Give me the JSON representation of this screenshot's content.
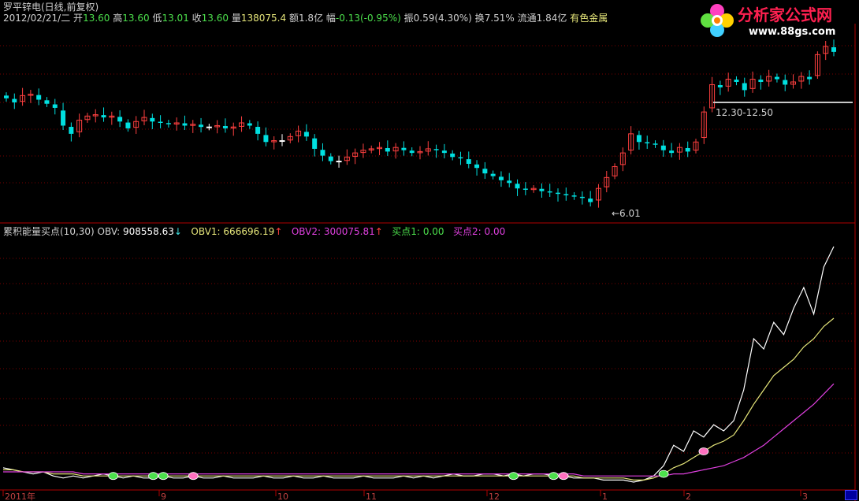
{
  "header": {
    "title": "罗平锌电(日线,前复权)",
    "date": "2012/02/21/二",
    "open_label": "开",
    "open": "13.60",
    "high_label": "高",
    "high": "13.60",
    "low_label": "低",
    "low": "13.01",
    "close_label": "收",
    "close": "13.60",
    "volume_label": "量",
    "volume": "138075.4",
    "amount_label": "额",
    "amount": "1.8亿",
    "change_label": "幅",
    "change": "-0.13(-0.95%)",
    "amplitude_label": "振",
    "amplitude": "0.59(4.30%)",
    "turnover_label": "换",
    "turnover": "7.51%",
    "float_label": "流通",
    "float": "1.84亿",
    "sector": "有色金属"
  },
  "logo": {
    "name": "分析家公式网",
    "url": "www.88gs.com"
  },
  "price_annotations": {
    "high_range": "12.30-12.50",
    "low_marker": "←6.01"
  },
  "indicator": {
    "name": "累积能量买点(10,30)",
    "obv_label": "OBV:",
    "obv": "908558.63",
    "obv_arrow": "↓",
    "obv1_label": "OBV1:",
    "obv1": "666696.19",
    "obv1_arrow": "↑",
    "obv2_label": "OBV2:",
    "obv2": "300075.81",
    "obv2_arrow": "↑",
    "buy1_label": "买点1:",
    "buy1": "0.00",
    "buy2_label": "买点2:",
    "buy2": "0.00"
  },
  "xaxis": {
    "labels": [
      "2011年",
      "9",
      "10",
      "11",
      "12",
      "1",
      "2",
      "3"
    ]
  },
  "colors": {
    "up": "#ff4040",
    "down": "#00e0e0",
    "doji": "#ffffff",
    "obv": "#ffffff",
    "obv1": "#e6e67a",
    "obv2": "#e040e0",
    "buy1": "#4ce04c",
    "buy2": "#ff70c0",
    "grid": "#7a0000"
  },
  "chart_data": [
    {
      "type": "candlestick",
      "title": "罗平锌电(日线,前复权)",
      "y_markers": {
        "high": "12.30-12.50",
        "low": 6.01
      },
      "series": [
        {
          "closes": [
            9.9,
            9.75,
            10.0,
            10.05,
            9.85,
            9.7,
            9.55,
            8.9,
            8.6,
            9.1,
            9.25,
            9.3,
            9.2,
            9.25,
            9.05,
            8.8,
            9.05,
            9.2,
            9.05,
            9.0,
            8.95,
            9.0,
            8.9,
            8.95,
            8.85,
            8.85,
            8.9,
            8.8,
            8.85,
            9.0,
            8.9,
            8.6,
            8.3,
            8.35,
            8.35,
            8.5,
            8.7,
            8.5,
            8.05,
            7.8,
            7.6,
            7.6,
            7.75,
            7.9,
            8.0,
            8.05,
            8.1,
            7.95,
            8.1,
            8.0,
            7.9,
            7.95,
            8.05,
            8.0,
            7.9,
            7.75,
            7.7,
            7.5,
            7.35,
            7.15,
            7.05,
            6.9,
            6.8,
            6.6,
            6.55,
            6.6,
            6.5,
            6.45,
            6.4,
            6.35,
            6.3,
            6.25,
            6.1,
            6.6,
            7.0,
            7.4,
            7.9,
            8.6,
            8.3,
            8.25,
            8.2,
            8.0,
            7.9,
            8.1,
            7.95,
            8.3,
            9.4,
            10.4,
            10.3,
            10.6,
            10.5,
            10.2,
            10.6,
            10.5,
            10.7,
            10.6,
            10.4,
            10.5,
            10.7,
            10.6,
            11.5,
            11.8,
            11.6
          ]
        }
      ]
    },
    {
      "type": "line",
      "title": "累积能量买点(10,30)",
      "series": [
        {
          "name": "OBV",
          "values": [
            0.07,
            0.06,
            0.05,
            0.04,
            0.05,
            0.03,
            0.02,
            0.03,
            0.02,
            0.03,
            0.04,
            0.03,
            0.02,
            0.03,
            0.02,
            0.02,
            0.03,
            0.02,
            0.02,
            0.03,
            0.02,
            0.02,
            0.03,
            0.02,
            0.02,
            0.02,
            0.03,
            0.02,
            0.02,
            0.03,
            0.02,
            0.02,
            0.03,
            0.02,
            0.02,
            0.02,
            0.03,
            0.02,
            0.02,
            0.02,
            0.03,
            0.02,
            0.03,
            0.02,
            0.03,
            0.04,
            0.03,
            0.03,
            0.04,
            0.04,
            0.03,
            0.04,
            0.03,
            0.04,
            0.04,
            0.03,
            0.03,
            0.02,
            0.02,
            0.02,
            0.01,
            0.01,
            0.01,
            0.0,
            0.01,
            0.03,
            0.08,
            0.18,
            0.15,
            0.25,
            0.22,
            0.28,
            0.25,
            0.3,
            0.45,
            0.7,
            0.65,
            0.78,
            0.72,
            0.85,
            0.95,
            0.82,
            1.05,
            1.15
          ]
        },
        {
          "name": "OBV1",
          "values": [
            0.06,
            0.06,
            0.05,
            0.05,
            0.05,
            0.04,
            0.04,
            0.04,
            0.03,
            0.03,
            0.03,
            0.03,
            0.03,
            0.03,
            0.03,
            0.03,
            0.03,
            0.03,
            0.03,
            0.03,
            0.03,
            0.03,
            0.03,
            0.03,
            0.03,
            0.03,
            0.03,
            0.03,
            0.03,
            0.03,
            0.03,
            0.03,
            0.03,
            0.03,
            0.03,
            0.03,
            0.03,
            0.03,
            0.03,
            0.03,
            0.03,
            0.03,
            0.03,
            0.03,
            0.03,
            0.03,
            0.03,
            0.03,
            0.03,
            0.03,
            0.03,
            0.03,
            0.03,
            0.03,
            0.03,
            0.03,
            0.03,
            0.03,
            0.02,
            0.02,
            0.02,
            0.02,
            0.02,
            0.01,
            0.01,
            0.02,
            0.04,
            0.07,
            0.09,
            0.12,
            0.15,
            0.18,
            0.2,
            0.23,
            0.3,
            0.38,
            0.45,
            0.52,
            0.56,
            0.6,
            0.66,
            0.7,
            0.76,
            0.8
          ]
        },
        {
          "name": "OBV2",
          "values": [
            0.05,
            0.05,
            0.05,
            0.05,
            0.05,
            0.05,
            0.05,
            0.05,
            0.04,
            0.04,
            0.04,
            0.04,
            0.04,
            0.04,
            0.04,
            0.04,
            0.04,
            0.04,
            0.04,
            0.04,
            0.04,
            0.04,
            0.04,
            0.04,
            0.04,
            0.04,
            0.04,
            0.04,
            0.04,
            0.04,
            0.04,
            0.04,
            0.04,
            0.04,
            0.04,
            0.04,
            0.04,
            0.04,
            0.04,
            0.04,
            0.04,
            0.04,
            0.04,
            0.04,
            0.04,
            0.04,
            0.04,
            0.04,
            0.04,
            0.04,
            0.04,
            0.04,
            0.04,
            0.04,
            0.04,
            0.04,
            0.04,
            0.04,
            0.03,
            0.03,
            0.03,
            0.03,
            0.03,
            0.03,
            0.03,
            0.03,
            0.03,
            0.04,
            0.04,
            0.05,
            0.06,
            0.07,
            0.08,
            0.1,
            0.12,
            0.15,
            0.18,
            0.22,
            0.26,
            0.3,
            0.34,
            0.38,
            0.43,
            0.48
          ]
        }
      ],
      "markers": {
        "buy1_x": [
          11,
          15,
          16,
          51,
          55,
          66
        ],
        "buy2_x": [
          19,
          56,
          70
        ]
      }
    }
  ]
}
